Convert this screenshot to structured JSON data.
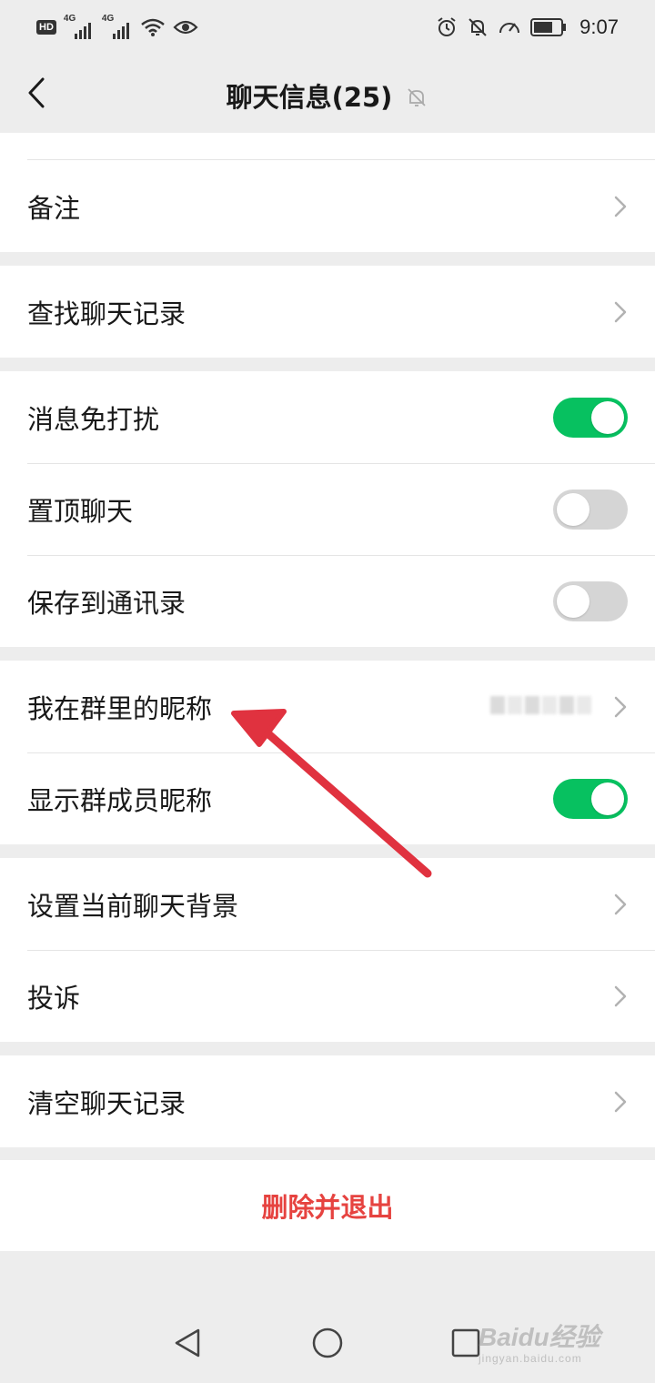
{
  "status_bar": {
    "left_badges": [
      "HD",
      "4G",
      "4G"
    ],
    "time": "9:07",
    "icons": [
      "hd-icon",
      "signal-icon",
      "signal-icon",
      "wifi-icon",
      "eye-icon",
      "alarm-icon",
      "bell-off-icon",
      "speedometer-icon",
      "battery-icon"
    ]
  },
  "nav": {
    "title": "聊天信息(25)",
    "back_icon": "chevron-left-icon",
    "mute_icon": "bell-off-icon"
  },
  "groups": [
    {
      "rows": [
        {
          "label": "备注",
          "control": "chevron"
        }
      ]
    },
    {
      "rows": [
        {
          "label": "查找聊天记录",
          "control": "chevron"
        }
      ]
    },
    {
      "rows": [
        {
          "label": "消息免打扰",
          "control": "toggle",
          "on": true
        },
        {
          "label": "置顶聊天",
          "control": "toggle",
          "on": false
        },
        {
          "label": "保存到通讯录",
          "control": "toggle",
          "on": false
        }
      ]
    },
    {
      "rows": [
        {
          "label": "我在群里的昵称",
          "control": "chevron",
          "value": "blurred"
        },
        {
          "label": "显示群成员昵称",
          "control": "toggle",
          "on": true
        }
      ]
    },
    {
      "rows": [
        {
          "label": "设置当前聊天背景",
          "control": "chevron"
        },
        {
          "label": "投诉",
          "control": "chevron"
        }
      ]
    },
    {
      "rows": [
        {
          "label": "清空聊天记录",
          "control": "chevron"
        }
      ]
    }
  ],
  "delete_exit": {
    "label": "删除并退出",
    "color": "#e64340"
  },
  "colors": {
    "toggle_on": "#07c160",
    "toggle_off": "#d5d5d5",
    "background": "#ededed",
    "annotation_arrow": "#e0323f"
  },
  "system_nav": {
    "icons": [
      "back-triangle-icon",
      "home-circle-icon",
      "recents-square-icon"
    ]
  },
  "watermark": {
    "brand": "Baidu经验",
    "url": "jingyan.baidu.com"
  }
}
